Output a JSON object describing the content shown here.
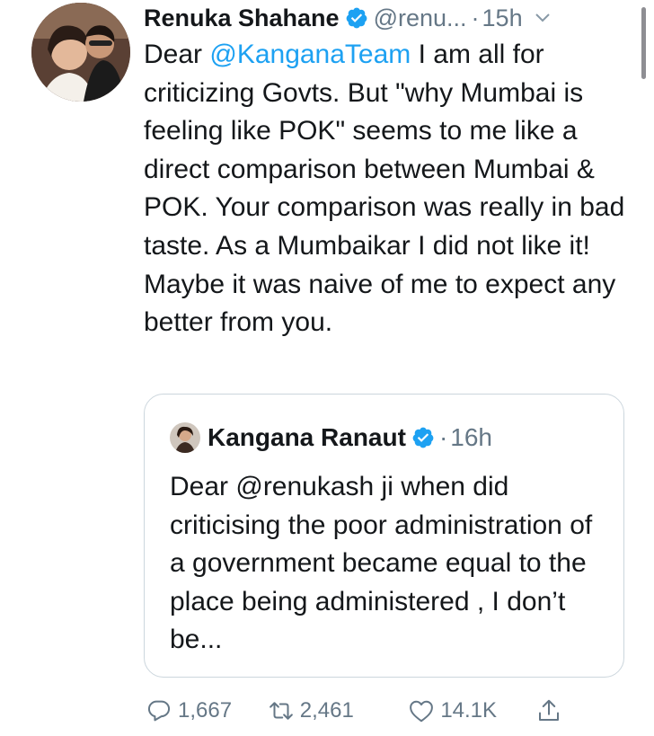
{
  "tweet": {
    "display_name": "Renuka Shahane",
    "handle": "@renu...",
    "separator": "·",
    "time": "15h",
    "text_parts": {
      "before_mention": "Dear ",
      "mention": "@KanganaTeam",
      "after_mention": " I am all for criticizing Govts. But \"why Mumbai is feeling like POK\" seems to me like a direct comparison between Mumbai & POK. Your comparison was really in bad taste. As a Mumbaikar I did not like it! Maybe it was naive of me to expect any better from you."
    }
  },
  "quoted_tweet": {
    "display_name": "Kangana Ranaut",
    "separator": "·",
    "time": "16h",
    "text": "Dear @renukash ji when did criticising the poor administration of a government became equal to the place being administered , I don’t be..."
  },
  "actions": {
    "replies": "1,667",
    "retweets": "2,461",
    "likes": "14.1K"
  },
  "colors": {
    "accent": "#1da1f2",
    "secondary_text": "#657786",
    "border": "#ccd6dd"
  },
  "icons": [
    "verified-badge-icon",
    "chevron-down-icon",
    "reply-icon",
    "retweet-icon",
    "like-icon",
    "share-icon"
  ]
}
